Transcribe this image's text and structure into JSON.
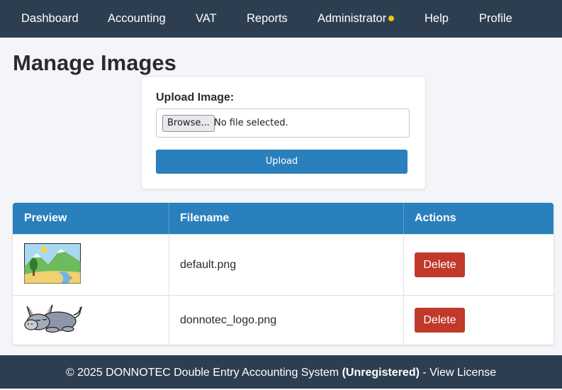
{
  "nav": {
    "items": [
      {
        "label": "Dashboard"
      },
      {
        "label": "Accounting"
      },
      {
        "label": "VAT"
      },
      {
        "label": "Reports"
      },
      {
        "label": "Administrator"
      },
      {
        "label": "Help"
      },
      {
        "label": "Profile"
      }
    ]
  },
  "page": {
    "title": "Manage Images"
  },
  "upload": {
    "label": "Upload Image:",
    "browse_label": "Browse...",
    "file_status": "No file selected.",
    "button_label": "Upload"
  },
  "table": {
    "headers": [
      "Preview",
      "Filename",
      "Actions"
    ],
    "rows": [
      {
        "preview_icon": "landscape-image-icon",
        "filename": "default.png",
        "action": "Delete"
      },
      {
        "preview_icon": "donkey-logo-icon",
        "filename": "donnotec_logo.png",
        "action": "Delete"
      }
    ]
  },
  "footer": {
    "copyright": "© 2025 DONNOTEC Double Entry Accounting System",
    "status": "(Unregistered)",
    "separator": "-",
    "license_link": "View License"
  },
  "colors": {
    "navbar": "#2d3e50",
    "primary": "#2a7fbd",
    "danger": "#c0392b",
    "notification_dot": "#f1c40f"
  }
}
